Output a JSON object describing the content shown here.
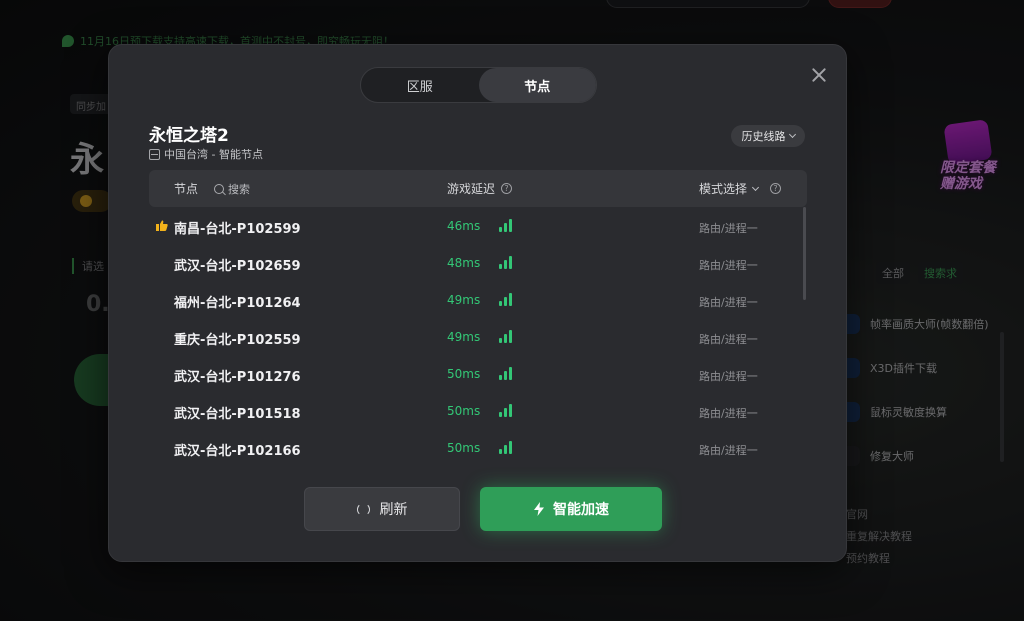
{
  "background": {
    "notice": "11月16日预下载支持高速下载，首测中不封号，即究畅玩无阻！",
    "sync_label": "同步加",
    "big_char": "永",
    "select_hint": "请选",
    "zero": "0.",
    "promo_text": "限定套餐 赠游戏",
    "tags": [
      "全部",
      "搜索求"
    ],
    "tools": [
      "帧率画质大师(帧数翻倍)",
      "X3D插件下载",
      "鼠标灵敏度换算",
      "修复大师"
    ],
    "links": [
      "官网",
      "重复解决教程",
      "预约教程"
    ]
  },
  "modal": {
    "tabs": [
      {
        "label": "区服",
        "active": false
      },
      {
        "label": "节点",
        "active": true
      }
    ],
    "game_title": "永恒之塔2",
    "game_sub": "中国台湾 - 智能节点",
    "history_button": "历史线路",
    "table": {
      "col_node": "节点",
      "search_placeholder": "搜索",
      "col_latency": "游戏延迟",
      "col_mode": "模式选择",
      "rows": [
        {
          "name": "南昌-台北-P102599",
          "latency": "46ms",
          "mode": "路由/进程一",
          "recommended": true
        },
        {
          "name": "武汉-台北-P102659",
          "latency": "48ms",
          "mode": "路由/进程一",
          "recommended": false
        },
        {
          "name": "福州-台北-P101264",
          "latency": "49ms",
          "mode": "路由/进程一",
          "recommended": false
        },
        {
          "name": "重庆-台北-P102559",
          "latency": "49ms",
          "mode": "路由/进程一",
          "recommended": false
        },
        {
          "name": "武汉-台北-P101276",
          "latency": "50ms",
          "mode": "路由/进程一",
          "recommended": false
        },
        {
          "name": "武汉-台北-P101518",
          "latency": "50ms",
          "mode": "路由/进程一",
          "recommended": false
        },
        {
          "name": "武汉-台北-P102166",
          "latency": "50ms",
          "mode": "路由/进程一",
          "recommended": false
        }
      ]
    },
    "refresh_button": "刷新",
    "accelerate_button": "智能加速"
  },
  "colors": {
    "accent_green": "#2f9e58",
    "latency_green": "#33c776",
    "modal_bg": "#2a2b2f"
  }
}
